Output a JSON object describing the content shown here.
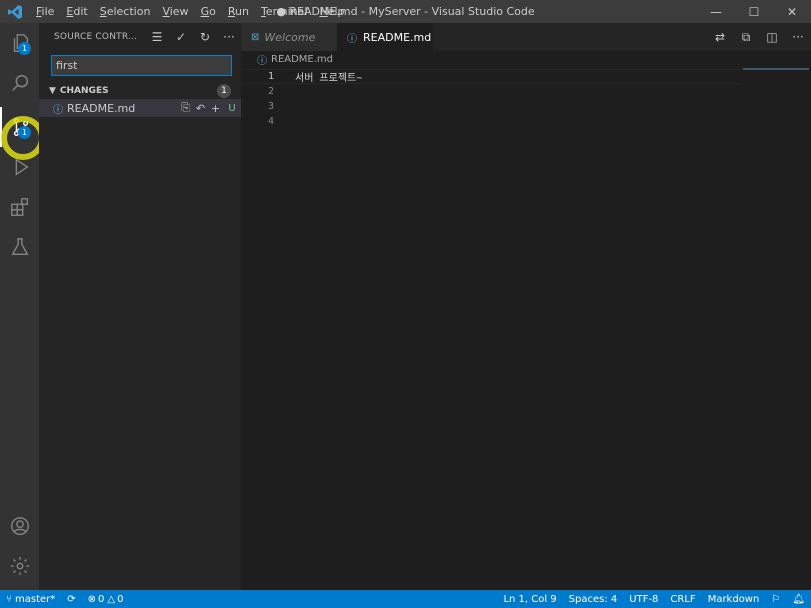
{
  "window": {
    "title": "● README.md - MyServer - Visual Studio Code",
    "menu": [
      "File",
      "Edit",
      "Selection",
      "View",
      "Go",
      "Run",
      "Terminal",
      "Help"
    ],
    "controls": {
      "minimize": "—",
      "maximize": "☐",
      "close": "✕"
    }
  },
  "activity_bar": {
    "explorer_badge": "1",
    "scm_badge": "1",
    "items": [
      "explorer-icon",
      "search-icon",
      "source-control-icon",
      "run-debug-icon",
      "extensions-icon",
      "testing-icon",
      "account-icon",
      "settings-gear-icon"
    ]
  },
  "sidebar": {
    "title": "SOURCE CONTR...",
    "commit_message": "first",
    "changes_label": "CHANGES",
    "changes_count": "1",
    "change": {
      "file": "README.md",
      "status": "U"
    }
  },
  "editor": {
    "tabs": [
      {
        "label": "Welcome",
        "active": false
      },
      {
        "label": "README.md",
        "active": true,
        "dirty": true
      }
    ],
    "breadcrumb": "README.md",
    "lines": [
      {
        "num": "1",
        "text": "서버 프로젝트~"
      },
      {
        "num": "2",
        "text": ""
      },
      {
        "num": "3",
        "text": ""
      },
      {
        "num": "4",
        "text": ""
      }
    ]
  },
  "status_bar": {
    "branch": "master*",
    "errors": "0",
    "warnings": "0",
    "position": "Ln 1, Col 9",
    "spaces": "Spaces: 4",
    "encoding": "UTF-8",
    "eol": "CRLF",
    "language": "Markdown"
  },
  "colors": {
    "accent": "#007acc",
    "status_bar": "#007acc",
    "untracked": "#73c991"
  }
}
